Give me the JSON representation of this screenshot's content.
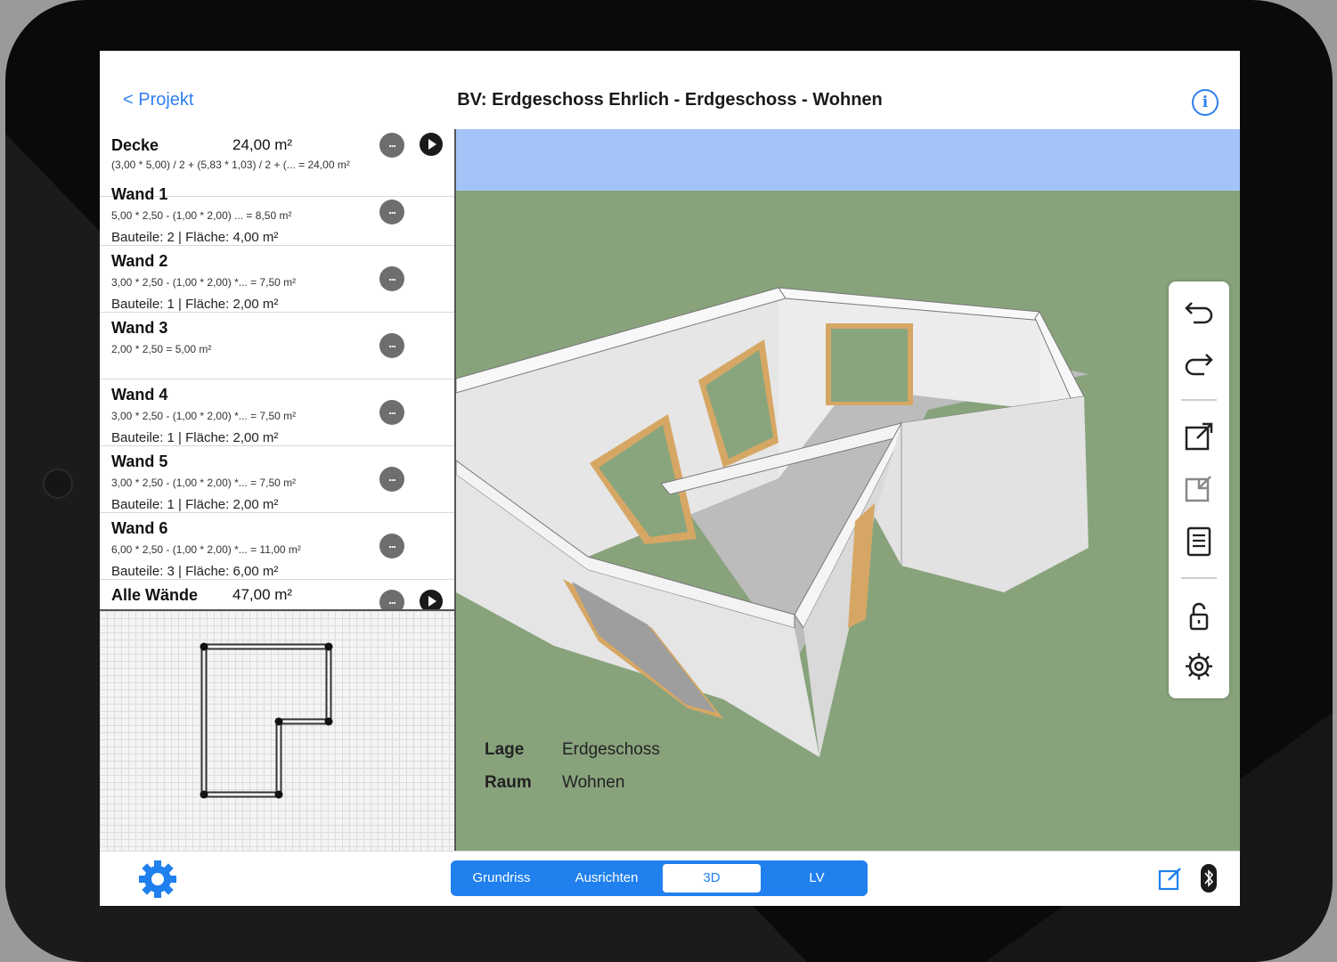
{
  "nav": {
    "back_label": "< Projekt",
    "title": "BV: Erdgeschoss Ehrlich - Erdgeschoss - Wohnen",
    "info_icon": "info-icon"
  },
  "list": {
    "rows": [
      {
        "name": "Decke",
        "area": "24,00 m²",
        "formula": "(3,00 * 5,00) / 2  + (5,83 * 1,03) / 2  + (... = 24,00 m²",
        "meta": "",
        "has_play": true
      },
      {
        "name": "Wand 1",
        "area": "",
        "formula": "5,00 * 2,50  - (1,00 * 2,00)  ... = 8,50 m²",
        "meta": "Bauteile: 2 | Fläche: 4,00 m²",
        "has_play": false
      },
      {
        "name": "Wand 2",
        "area": "",
        "formula": "3,00 * 2,50  - (1,00 * 2,00) *... = 7,50 m²",
        "meta": "Bauteile: 1 | Fläche: 2,00 m²",
        "has_play": false
      },
      {
        "name": "Wand 3",
        "area": "",
        "formula": "2,00 * 2,50   = 5,00 m²",
        "meta": "",
        "has_play": false
      },
      {
        "name": "Wand 4",
        "area": "",
        "formula": "3,00 * 2,50  - (1,00 * 2,00) *... = 7,50 m²",
        "meta": "Bauteile: 1 | Fläche: 2,00 m²",
        "has_play": false
      },
      {
        "name": "Wand 5",
        "area": "",
        "formula": "3,00 * 2,50  - (1,00 * 2,00) *... = 7,50 m²",
        "meta": "Bauteile: 1 | Fläche: 2,00 m²",
        "has_play": false
      },
      {
        "name": "Wand 6",
        "area": "",
        "formula": "6,00 * 2,50  - (1,00 * 2,00) *... = 11,00 m²",
        "meta": "Bauteile: 3 | Fläche: 6,00 m²",
        "has_play": false
      },
      {
        "name": "Alle Wände",
        "area": "47,00 m²",
        "formula": "",
        "meta": "",
        "has_play": true
      }
    ],
    "more_label": "..."
  },
  "properties": [
    {
      "label": "Lage",
      "value": "Erdgeschoss"
    },
    {
      "label": "Raum",
      "value": "Wohnen"
    }
  ],
  "toolbar": [
    "undo-icon",
    "redo-icon",
    "export-icon",
    "import-icon",
    "document-icon",
    "lock-icon",
    "gear-icon"
  ],
  "tabs": [
    {
      "label": "Grundriss",
      "selected": false
    },
    {
      "label": "Ausrichten",
      "selected": false
    },
    {
      "label": "3D",
      "selected": true
    },
    {
      "label": "LV",
      "selected": false
    }
  ],
  "colors": {
    "accent": "#1f80ee",
    "ground": "#88a37c",
    "sky": "#a4c3f7"
  }
}
